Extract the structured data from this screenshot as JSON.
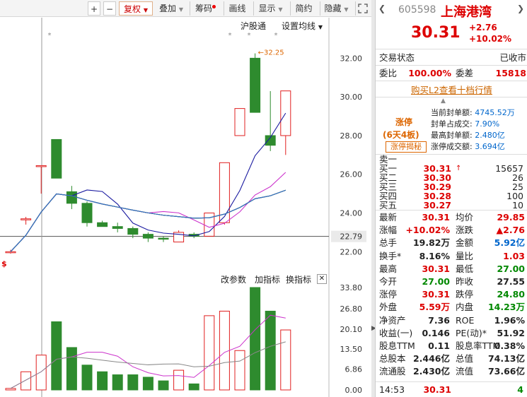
{
  "toolbar": {
    "plus": "+",
    "minus": "−",
    "adjust": "复权",
    "overlay": "叠加",
    "chips": "筹码",
    "draw": "画线",
    "display": "显示",
    "simple": "简约",
    "hide": "隐藏"
  },
  "main_header": {
    "hgt": "沪股通",
    "ma_settings": "设置均线"
  },
  "sub_header": {
    "modify_params": "改参数",
    "add_indicator": "加指标",
    "switch_indicator": "换指标"
  },
  "price_axis": [
    "32.00",
    "30.00",
    "28.00",
    "26.00",
    "24.00",
    "22.79",
    "22.00"
  ],
  "current_price_line": "22.79",
  "max_annotation": "32.25",
  "vol_axis": [
    "33.80",
    "26.80",
    "20.10",
    "13.50",
    "6.86",
    "0.00"
  ],
  "chart_data": {
    "type": "candlestick",
    "candles": [
      {
        "o": 22.0,
        "h": 22.1,
        "l": 21.9,
        "c": 22.0,
        "dir": "up"
      },
      {
        "o": 23.7,
        "h": 23.8,
        "l": 23.4,
        "c": 23.7,
        "dir": "up"
      },
      {
        "o": 26.4,
        "h": 26.45,
        "l": 25.0,
        "c": 26.45,
        "dir": "up"
      },
      {
        "o": 25.8,
        "h": 27.8,
        "l": 25.8,
        "c": 27.8,
        "dir": "down"
      },
      {
        "o": 25.1,
        "h": 25.4,
        "l": 24.2,
        "c": 24.5,
        "dir": "down"
      },
      {
        "o": 24.5,
        "h": 24.6,
        "l": 23.3,
        "c": 23.5,
        "dir": "down"
      },
      {
        "o": 23.5,
        "h": 23.6,
        "l": 23.3,
        "c": 23.3,
        "dir": "down"
      },
      {
        "o": 23.3,
        "h": 23.5,
        "l": 23.0,
        "c": 23.2,
        "dir": "down"
      },
      {
        "o": 23.2,
        "h": 23.3,
        "l": 22.7,
        "c": 22.9,
        "dir": "down"
      },
      {
        "o": 22.9,
        "h": 23.0,
        "l": 22.5,
        "c": 22.7,
        "dir": "down"
      },
      {
        "o": 22.7,
        "h": 22.8,
        "l": 22.5,
        "c": 22.7,
        "dir": "down"
      },
      {
        "o": 22.5,
        "h": 23.1,
        "l": 22.5,
        "c": 23.0,
        "dir": "up"
      },
      {
        "o": 22.9,
        "h": 23.0,
        "l": 22.7,
        "c": 22.8,
        "dir": "down"
      },
      {
        "o": 22.8,
        "h": 24.0,
        "l": 22.8,
        "c": 24.0,
        "dir": "up"
      },
      {
        "o": 23.5,
        "h": 26.6,
        "l": 23.4,
        "c": 26.6,
        "dir": "up"
      },
      {
        "o": 28.0,
        "h": 29.4,
        "l": 28.0,
        "c": 29.4,
        "dir": "up"
      },
      {
        "o": 29.2,
        "h": 32.25,
        "l": 29.2,
        "c": 32.0,
        "dir": "down"
      },
      {
        "o": 28.0,
        "h": 30.3,
        "l": 27.2,
        "c": 27.5,
        "dir": "down"
      },
      {
        "o": 28.0,
        "h": 30.31,
        "l": 27.0,
        "c": 30.31,
        "dir": "up"
      }
    ],
    "volume": [
      {
        "v": 0.5,
        "dir": "up"
      },
      {
        "v": 6.0,
        "dir": "up"
      },
      {
        "v": 11.5,
        "dir": "up"
      },
      {
        "v": 22.5,
        "dir": "down"
      },
      {
        "v": 14.0,
        "dir": "down"
      },
      {
        "v": 8.2,
        "dir": "down"
      },
      {
        "v": 6.0,
        "dir": "down"
      },
      {
        "v": 5.0,
        "dir": "down"
      },
      {
        "v": 5.0,
        "dir": "down"
      },
      {
        "v": 4.2,
        "dir": "down"
      },
      {
        "v": 3.0,
        "dir": "down"
      },
      {
        "v": 6.5,
        "dir": "up"
      },
      {
        "v": 2.0,
        "dir": "down"
      },
      {
        "v": 24.5,
        "dir": "up"
      },
      {
        "v": 26.0,
        "dir": "up"
      },
      {
        "v": 13.0,
        "dir": "up"
      },
      {
        "v": 33.8,
        "dir": "down"
      },
      {
        "v": 26.0,
        "dir": "down"
      },
      {
        "v": 19.8,
        "dir": "up"
      }
    ],
    "ylim": [
      21.5,
      33.0
    ],
    "vol_ylim": [
      0,
      33.8
    ]
  },
  "stock": {
    "code": "605598",
    "name": "上海港湾",
    "price": "30.31",
    "change": "+2.76",
    "change_pct": "+10.02%",
    "trade_status_label": "交易状态",
    "trade_status": "已收市",
    "weibi_label": "委比",
    "weibi": "100.00%",
    "weicha_label": "委差",
    "weicha": "15818",
    "l2_link": "购买L2查看十档行情"
  },
  "limit_up": {
    "title": "涨停",
    "days": "(6天4板)",
    "reveal_btn": "涨停揭秘",
    "seal_amount_label": "当前封单额:",
    "seal_amount": "4745.52万",
    "seal_ratio_label": "封单占成交:",
    "seal_ratio": "7.90%",
    "max_seal_label": "最高封单额:",
    "max_seal": "2.480亿",
    "limit_turnover_label": "涨停成交额:",
    "limit_turnover": "3.694亿"
  },
  "order_book": [
    {
      "label": "卖一",
      "price": "",
      "vol": ""
    },
    {
      "label": "买一",
      "price": "30.31",
      "vol": "15657"
    },
    {
      "label": "买二",
      "price": "30.30",
      "vol": "26"
    },
    {
      "label": "买三",
      "price": "30.29",
      "vol": "25"
    },
    {
      "label": "买四",
      "price": "30.28",
      "vol": "100"
    },
    {
      "label": "买五",
      "price": "30.27",
      "vol": "10"
    }
  ],
  "stats": [
    {
      "l1": "最新",
      "v1": "30.31",
      "c1": "red",
      "l2": "均价",
      "v2": "29.85",
      "c2": "red"
    },
    {
      "l1": "涨幅",
      "v1": "+10.02%",
      "c1": "red",
      "l2": "涨跌",
      "v2": "▲2.76",
      "c2": "red"
    },
    {
      "l1": "总手",
      "v1": "19.82万",
      "c1": "",
      "l2": "金额",
      "v2": "5.92亿",
      "c2": "blue"
    },
    {
      "l1": "换手*",
      "v1": "8.16%",
      "c1": "",
      "l2": "量比",
      "v2": "1.03",
      "c2": "red"
    },
    {
      "l1": "最高",
      "v1": "30.31",
      "c1": "red",
      "l2": "最低",
      "v2": "27.00",
      "c2": "green"
    },
    {
      "l1": "今开",
      "v1": "27.00",
      "c1": "green",
      "l2": "昨收",
      "v2": "27.55",
      "c2": ""
    },
    {
      "l1": "涨停",
      "v1": "30.31",
      "c1": "red",
      "l2": "跌停",
      "v2": "24.80",
      "c2": "green"
    },
    {
      "l1": "外盘",
      "v1": "5.59万",
      "c1": "red",
      "l2": "内盘",
      "v2": "14.23万",
      "c2": "green"
    },
    {
      "l1": "净资产",
      "v1": "7.36",
      "c1": "",
      "l2": "ROE",
      "v2": "1.96%",
      "c2": ""
    },
    {
      "l1": "收益(一)",
      "v1": "0.146",
      "c1": "",
      "l2": "PE(动)*",
      "v2": "51.92",
      "c2": ""
    },
    {
      "l1": "股息TTM",
      "v1": "0.11",
      "c1": "",
      "l2": "股息率TTM",
      "v2": "0.38%",
      "c2": ""
    },
    {
      "l1": "总股本",
      "v1": "2.446亿",
      "c1": "",
      "l2": "总值",
      "v2": "74.13亿",
      "c2": ""
    },
    {
      "l1": "流通股",
      "v1": "2.430亿",
      "c1": "",
      "l2": "流值",
      "v2": "73.66亿",
      "c2": ""
    }
  ],
  "tick": {
    "time": "14:53",
    "price": "30.31",
    "vol": "4"
  },
  "colors": {
    "up": "#e02020",
    "down": "#2e8b2e",
    "accent": "#d00"
  }
}
